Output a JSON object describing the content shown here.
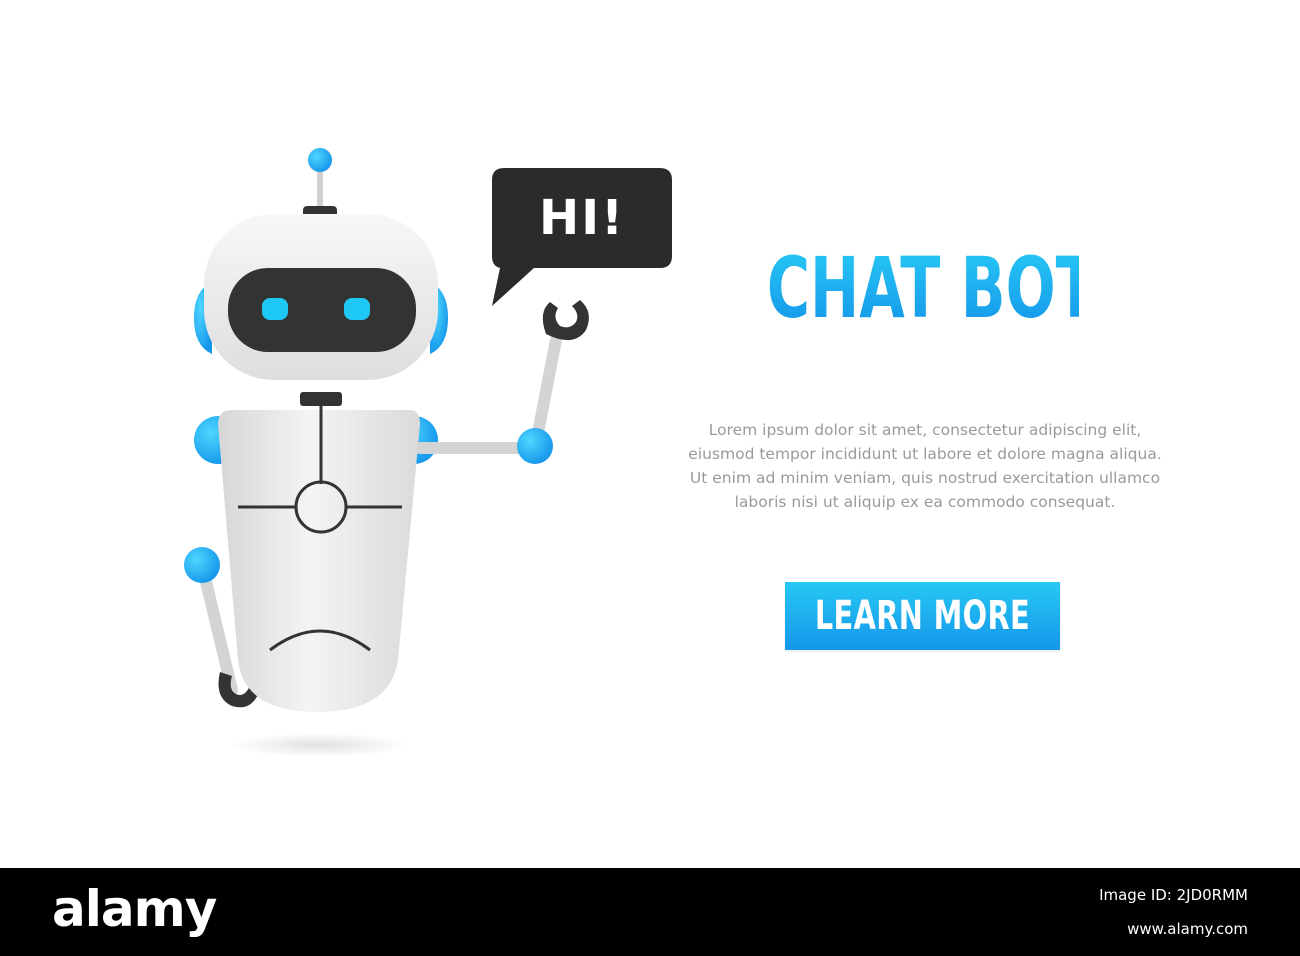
{
  "banner": {
    "bubble_text": "HI!",
    "headline": "CHAT BOT",
    "body_lines": [
      "Lorem ipsum dolor sit amet, consectetur adipiscing elit,",
      "eiusmod tempor incididunt ut labore et dolore magna aliqua.",
      "Ut enim ad minim veniam, quis nostrud exercitation ullamco",
      "laboris nisi ut aliquip ex ea commodo consequat."
    ],
    "button_label": "LEARN MORE",
    "colors": {
      "accent_top": "#27c8f4",
      "accent_bottom": "#1596ea",
      "bubble": "#2b2b2b",
      "robot_body": "#e6e6e6",
      "robot_dark": "#333333",
      "robot_eye": "#1ec8f5",
      "background": "#ffffff"
    },
    "icons": [
      "robot-illustration",
      "speech-bubble-icon"
    ]
  },
  "footer": {
    "logo": "alamy",
    "image_id_label": "Image ID: 2JD0RMM",
    "site": "www.alamy.com"
  }
}
